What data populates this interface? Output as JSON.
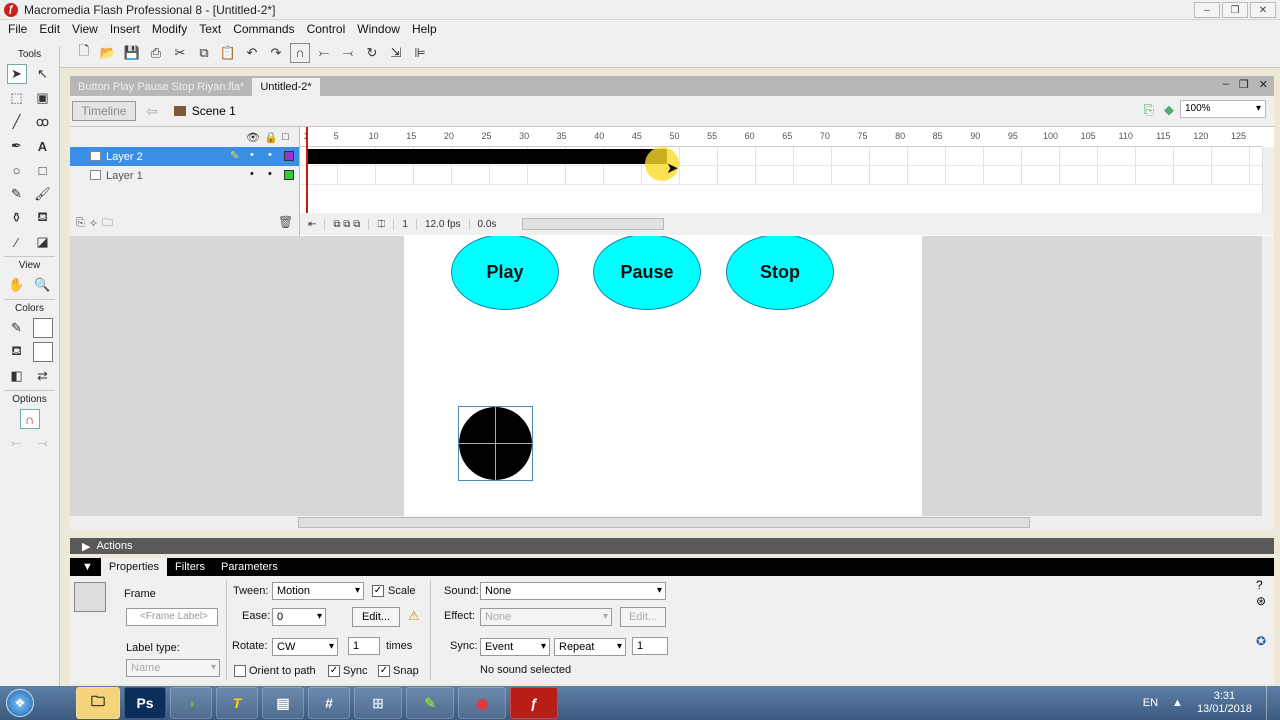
{
  "window": {
    "title": "Macromedia Flash Professional 8 - [Untitled-2*]",
    "controls": [
      "–",
      "❐",
      "✕"
    ]
  },
  "menu": [
    "File",
    "Edit",
    "View",
    "Insert",
    "Modify",
    "Text",
    "Commands",
    "Control",
    "Window",
    "Help"
  ],
  "tools_panel": {
    "tools_label": "Tools",
    "view_label": "View",
    "colors_label": "Colors",
    "options_label": "Options"
  },
  "doc_tabs": [
    "Button Play Pause Stop Riyan.fla*",
    "Untitled-2*"
  ],
  "timebar": {
    "timeline_button": "Timeline",
    "scene_label": "Scene 1",
    "zoom": "100%"
  },
  "timeline": {
    "layers": [
      {
        "name": "Layer 2",
        "selected": true,
        "color": "#9933cc"
      },
      {
        "name": "Layer 1",
        "selected": false,
        "color": "#33cc33"
      }
    ],
    "ruler_ticks": [
      "1",
      "5",
      "10",
      "15",
      "20",
      "25",
      "30",
      "35",
      "40",
      "45",
      "50",
      "55",
      "60",
      "65",
      "70",
      "75",
      "80",
      "85",
      "90",
      "95",
      "100",
      "105",
      "110",
      "115",
      "120",
      "125"
    ],
    "current_frame": "1",
    "fps": "12.0 fps",
    "time": "0.0s",
    "tween_end_frame": 48
  },
  "stage": {
    "buttons": [
      "Play",
      "Pause",
      "Stop"
    ],
    "button_color": "#00ffff"
  },
  "actions_panel": {
    "label": "Actions"
  },
  "properties": {
    "tabs": [
      "Properties",
      "Filters",
      "Parameters"
    ],
    "frame_label": "Frame",
    "frame_label_placeholder": "<Frame Label>",
    "label_type_label": "Label type:",
    "label_type_value": "Name",
    "tween_label": "Tween:",
    "tween_value": "Motion",
    "scale_label": "Scale",
    "ease_label": "Ease:",
    "ease_value": "0",
    "edit_button": "Edit...",
    "rotate_label": "Rotate:",
    "rotate_value": "CW",
    "times_value": "1",
    "times_label": "times",
    "orient_label": "Orient to path",
    "sync_label": "Sync",
    "snap_label": "Snap",
    "sound_label": "Sound:",
    "sound_value": "None",
    "effect_label": "Effect:",
    "effect_value": "None",
    "effect_edit": "Edit...",
    "sync2_label": "Sync:",
    "sync2_value": "Event",
    "repeat_value": "Repeat",
    "repeat_count": "1",
    "no_sound": "No sound selected"
  },
  "taskbar": {
    "apps": [
      "explorer",
      "Ps",
      "camtasia",
      "T",
      "document",
      "calculator",
      "file-manager",
      "edit",
      "chrome",
      "flash"
    ],
    "lang": "EN",
    "time": "3:31",
    "date": "13/01/2018"
  }
}
